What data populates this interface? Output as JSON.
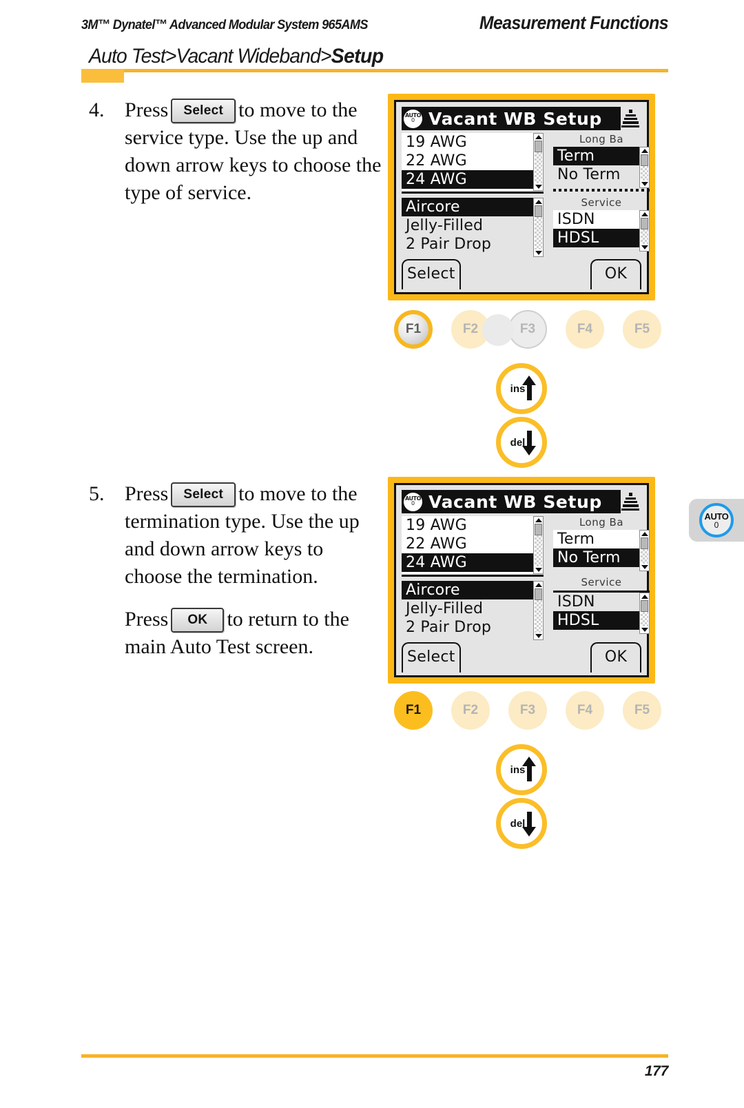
{
  "header": {
    "left": "3M™ Dynatel™ Advanced Modular System 965AMS",
    "right": "Measurement Functions",
    "breadcrumb_light": "Auto Test>Vacant Wideband>",
    "breadcrumb_bold": "Setup"
  },
  "footer": {
    "page_number": "177"
  },
  "steps": [
    {
      "number": "4.",
      "text_before": "Press",
      "key": "Select",
      "text_after": "to move to the service type. Use the up and down arrow keys to choose the type of service."
    },
    {
      "number": "5.",
      "text_before": "Press",
      "key": "Select",
      "text_after": "to move to the termination type. Use the up and down arrow keys to choose the termination.",
      "para2_before": "Press",
      "para2_key": "OK",
      "para2_after": "to return to the main Auto Test screen."
    }
  ],
  "screens": [
    {
      "title": "Vacant WB Setup",
      "badge_top": "AUTO",
      "badge_bottom": "0",
      "gauge_list": [
        {
          "label": "19 AWG",
          "selected": false
        },
        {
          "label": "22 AWG",
          "selected": false
        },
        {
          "label": "24 AWG",
          "selected": true
        }
      ],
      "cable_list": [
        {
          "label": "Aircore",
          "selected": true
        },
        {
          "label": "Jelly-Filled",
          "selected": false
        },
        {
          "label": "2 Pair Drop",
          "selected": false
        }
      ],
      "termination_label": "Long Ba",
      "termination_list": [
        {
          "label": "Term",
          "selected": true,
          "boxed": false
        },
        {
          "label": "No Term",
          "selected": false,
          "boxed": false
        }
      ],
      "service_label": "Service",
      "service_list": [
        {
          "label": "ISDN",
          "selected": false,
          "boxed": true
        },
        {
          "label": "HDSL",
          "selected": true,
          "boxed": false
        }
      ],
      "softkey_left": "Select",
      "softkey_right": "OK"
    },
    {
      "title": "Vacant WB Setup",
      "badge_top": "AUTO",
      "badge_bottom": "0",
      "gauge_list": [
        {
          "label": "19 AWG",
          "selected": false
        },
        {
          "label": "22 AWG",
          "selected": false
        },
        {
          "label": "24 AWG",
          "selected": true
        }
      ],
      "cable_list": [
        {
          "label": "Aircore",
          "selected": true
        },
        {
          "label": "Jelly-Filled",
          "selected": false
        },
        {
          "label": "2 Pair Drop",
          "selected": false
        }
      ],
      "termination_label": "Long Ba",
      "termination_list": [
        {
          "label": "Term",
          "selected": false,
          "boxed": true
        },
        {
          "label": "No Term",
          "selected": true,
          "boxed": false
        }
      ],
      "service_label": "Service",
      "service_list": [
        {
          "label": "ISDN",
          "selected": false,
          "boxed": false
        },
        {
          "label": "HDSL",
          "selected": true,
          "boxed": false
        }
      ],
      "softkey_left": "Select",
      "softkey_right": "OK"
    }
  ],
  "function_keys": {
    "labels": [
      "F1",
      "F2",
      "F3",
      "F4",
      "F5"
    ],
    "row1_active": "F1",
    "row2_active": "F1"
  },
  "edit_keys": {
    "insert_label": "ins",
    "delete_label": "del"
  },
  "edge_tab": {
    "top": "AUTO",
    "bottom": "0"
  },
  "colors": {
    "gold": "#F7B328",
    "gold_light": "#FCEBC4",
    "gold_active": "#FCBE1E",
    "lcd_bezel": "#FBB817",
    "lcd_bg": "#E4E4E4",
    "blue_ring": "#1E9BEA"
  }
}
